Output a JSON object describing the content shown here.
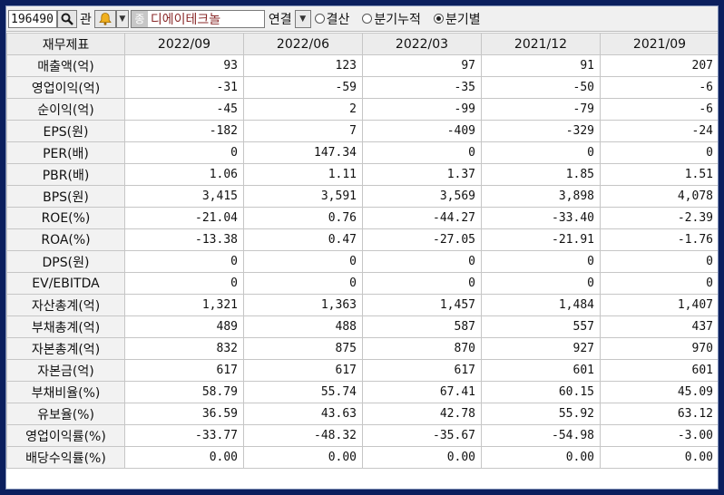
{
  "toolbar": {
    "code_value": "196490",
    "gwan_label": "관",
    "jong_tag": "종",
    "company_name": "디에이테크놀",
    "link_label": "연결",
    "radio_options": [
      {
        "label": "결산",
        "selected": false
      },
      {
        "label": "분기누적",
        "selected": false
      },
      {
        "label": "분기별",
        "selected": true
      }
    ]
  },
  "table": {
    "headers": [
      "재무제표",
      "2022/09",
      "2022/06",
      "2022/03",
      "2021/12",
      "2021/09"
    ],
    "rows": [
      {
        "label": "매출액(억)",
        "values": [
          "93",
          "123",
          "97",
          "91",
          "207"
        ]
      },
      {
        "label": "영업이익(억)",
        "values": [
          "-31",
          "-59",
          "-35",
          "-50",
          "-6"
        ]
      },
      {
        "label": "순이익(억)",
        "values": [
          "-45",
          "2",
          "-99",
          "-79",
          "-6"
        ]
      },
      {
        "label": "EPS(원)",
        "values": [
          "-182",
          "7",
          "-409",
          "-329",
          "-24"
        ]
      },
      {
        "label": "PER(배)",
        "values": [
          "0",
          "147.34",
          "0",
          "0",
          "0"
        ]
      },
      {
        "label": "PBR(배)",
        "values": [
          "1.06",
          "1.11",
          "1.37",
          "1.85",
          "1.51"
        ]
      },
      {
        "label": "BPS(원)",
        "values": [
          "3,415",
          "3,591",
          "3,569",
          "3,898",
          "4,078"
        ]
      },
      {
        "label": "ROE(%)",
        "values": [
          "-21.04",
          "0.76",
          "-44.27",
          "-33.40",
          "-2.39"
        ]
      },
      {
        "label": "ROA(%)",
        "values": [
          "-13.38",
          "0.47",
          "-27.05",
          "-21.91",
          "-1.76"
        ]
      },
      {
        "label": "DPS(원)",
        "values": [
          "0",
          "0",
          "0",
          "0",
          "0"
        ]
      },
      {
        "label": "EV/EBITDA",
        "values": [
          "0",
          "0",
          "0",
          "0",
          "0"
        ]
      },
      {
        "label": "자산총계(억)",
        "values": [
          "1,321",
          "1,363",
          "1,457",
          "1,484",
          "1,407"
        ]
      },
      {
        "label": "부채총계(억)",
        "values": [
          "489",
          "488",
          "587",
          "557",
          "437"
        ]
      },
      {
        "label": "자본총계(억)",
        "values": [
          "832",
          "875",
          "870",
          "927",
          "970"
        ]
      },
      {
        "label": "자본금(억)",
        "values": [
          "617",
          "617",
          "617",
          "601",
          "601"
        ]
      },
      {
        "label": "부채비율(%)",
        "values": [
          "58.79",
          "55.74",
          "67.41",
          "60.15",
          "45.09"
        ]
      },
      {
        "label": "유보율(%)",
        "values": [
          "36.59",
          "43.63",
          "42.78",
          "55.92",
          "63.12"
        ]
      },
      {
        "label": "영업이익률(%)",
        "values": [
          "-33.77",
          "-48.32",
          "-35.67",
          "-54.98",
          "-3.00"
        ]
      },
      {
        "label": "배당수익률(%)",
        "values": [
          "0.00",
          "0.00",
          "0.00",
          "0.00",
          "0.00"
        ]
      }
    ]
  }
}
